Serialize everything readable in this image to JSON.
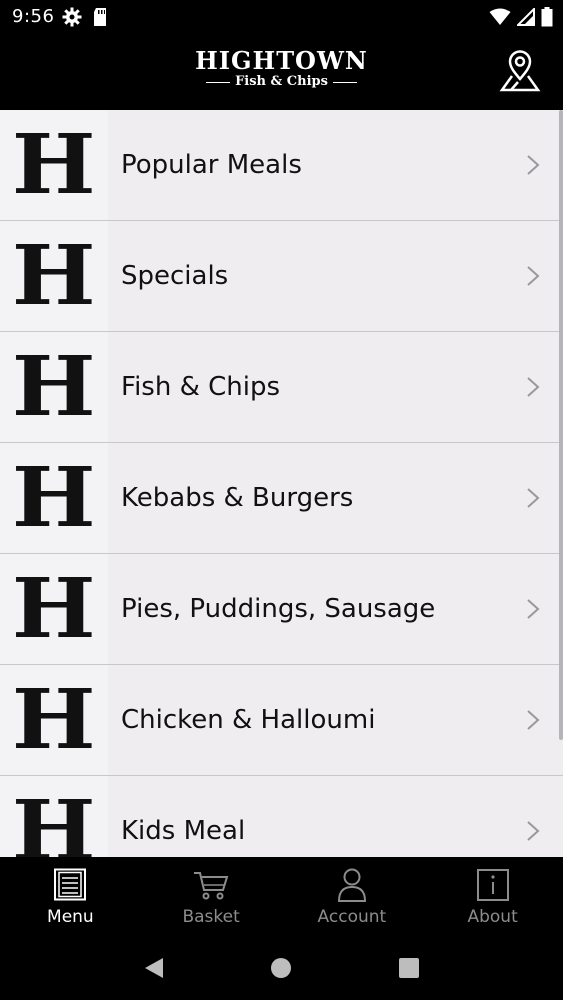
{
  "status_bar": {
    "time": "9:56",
    "icons": [
      "settings-icon",
      "sd-card-icon",
      "wifi-icon",
      "signal-icon",
      "battery-icon"
    ]
  },
  "header": {
    "brand_title": "HIGHTOWN",
    "brand_subtitle": "Fish & Chips",
    "location_icon": "map-pin-icon"
  },
  "menu": {
    "thumb_letter": "H",
    "items": [
      {
        "label": "Popular Meals"
      },
      {
        "label": "Specials"
      },
      {
        "label": "Fish & Chips"
      },
      {
        "label": "Kebabs & Burgers"
      },
      {
        "label": "Pies, Puddings, Sausage"
      },
      {
        "label": "Chicken & Halloumi"
      },
      {
        "label": "Kids Meal"
      }
    ]
  },
  "tabs": [
    {
      "label": "Menu",
      "icon": "menu-list-icon",
      "active": true
    },
    {
      "label": "Basket",
      "icon": "cart-icon",
      "active": false
    },
    {
      "label": "Account",
      "icon": "user-icon",
      "active": false
    },
    {
      "label": "About",
      "icon": "info-icon",
      "active": false
    }
  ],
  "colors": {
    "background": "#000000",
    "list_background": "#efedf0",
    "inactive_tab": "#8c8c8c",
    "active_tab": "#ffffff"
  }
}
